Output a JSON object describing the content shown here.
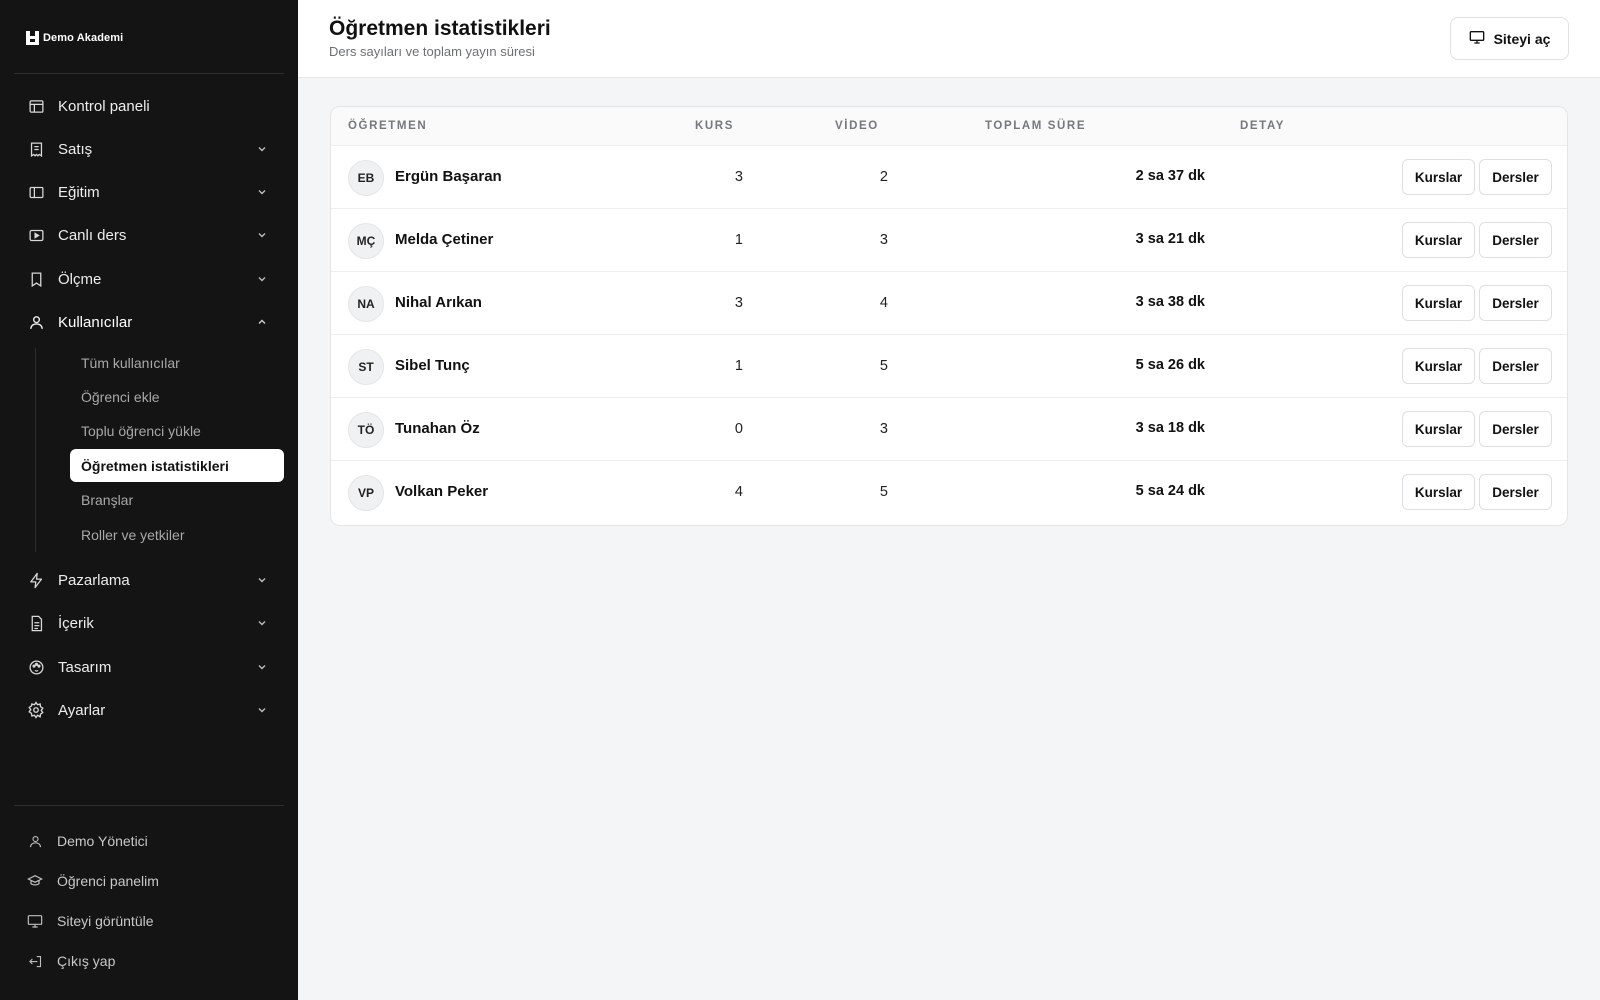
{
  "brand": {
    "name": "Demo Akademi",
    "icon": "logo-mark-icon"
  },
  "sidebar": {
    "nav": [
      {
        "label": "Kontrol paneli",
        "icon": "dashboard-icon",
        "chevron": "none"
      },
      {
        "label": "Satış",
        "icon": "receipt-icon",
        "chevron": "down"
      },
      {
        "label": "Eğitim",
        "icon": "book-open-icon",
        "chevron": "down"
      },
      {
        "label": "Canlı ders",
        "icon": "video-icon",
        "chevron": "down"
      },
      {
        "label": "Ölçme",
        "icon": "bookmark-icon",
        "chevron": "down"
      },
      {
        "label": "Kullanıcılar",
        "icon": "user-icon",
        "chevron": "up"
      },
      {
        "label": "Pazarlama",
        "icon": "lightning-icon",
        "chevron": "down"
      },
      {
        "label": "İçerik",
        "icon": "document-icon",
        "chevron": "down"
      },
      {
        "label": "Tasarım",
        "icon": "palette-icon",
        "chevron": "down"
      },
      {
        "label": "Ayarlar",
        "icon": "gear-icon",
        "chevron": "down"
      }
    ],
    "users_submenu": [
      {
        "label": "Tüm kullanıcılar"
      },
      {
        "label": "Öğrenci ekle"
      },
      {
        "label": "Toplu öğrenci yükle"
      },
      {
        "label": "Öğretmen istatistikleri",
        "active": true
      },
      {
        "label": "Branşlar"
      },
      {
        "label": "Roller ve yetkiler"
      }
    ],
    "footer": [
      {
        "label": "Demo Yönetici",
        "icon": "user-icon"
      },
      {
        "label": "Öğrenci panelim",
        "icon": "graduation-cap-icon"
      },
      {
        "label": "Siteyi görüntüle",
        "icon": "monitor-icon"
      },
      {
        "label": "Çıkış yap",
        "icon": "logout-icon"
      }
    ]
  },
  "header": {
    "title": "Öğretmen istatistikleri",
    "subtitle": "Ders sayıları ve toplam yayın süresi",
    "open_site_label": "Siteyi aç",
    "open_site_icon": "monitor-icon"
  },
  "table": {
    "columns": [
      "ÖĞRETMEN",
      "KURS",
      "VİDEO",
      "TOPLAM SÜRE",
      "DETAY"
    ],
    "courses_button": "Kurslar",
    "lessons_button": "Dersler",
    "rows": [
      {
        "initials": "EB",
        "name": "Ergün Başaran",
        "kurs": "3",
        "video": "2",
        "duration": "2 sa 37 dk"
      },
      {
        "initials": "MÇ",
        "name": "Melda Çetiner",
        "kurs": "1",
        "video": "3",
        "duration": "3 sa 21 dk"
      },
      {
        "initials": "NA",
        "name": "Nihal Arıkan",
        "kurs": "3",
        "video": "4",
        "duration": "3 sa 38 dk"
      },
      {
        "initials": "ST",
        "name": "Sibel Tunç",
        "kurs": "1",
        "video": "5",
        "duration": "5 sa 26 dk"
      },
      {
        "initials": "TÖ",
        "name": "Tunahan Öz",
        "kurs": "0",
        "video": "3",
        "duration": "3 sa 18 dk"
      },
      {
        "initials": "VP",
        "name": "Volkan Peker",
        "kurs": "4",
        "video": "5",
        "duration": "5 sa 24 dk"
      }
    ]
  },
  "colors": {
    "sidebar_bg": "#141414",
    "page_bg": "#f4f5f7",
    "accent": "#111111"
  }
}
